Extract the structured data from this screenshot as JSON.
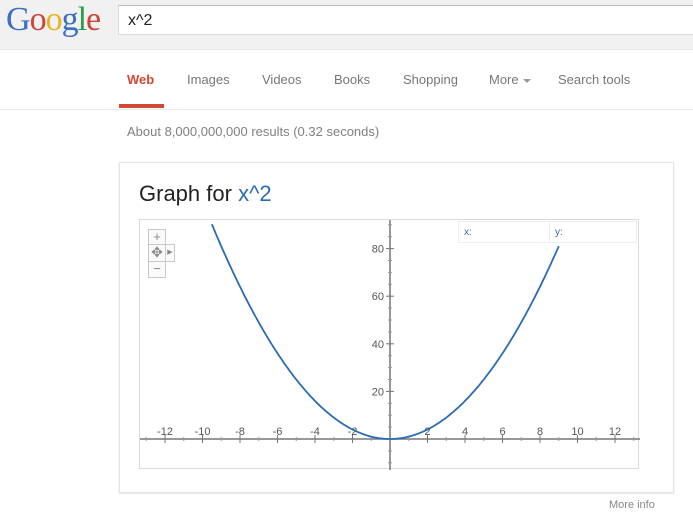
{
  "header": {
    "logo_letters": [
      "G",
      "o",
      "o",
      "g",
      "l",
      "e"
    ],
    "search_value": "x^2"
  },
  "tabs": [
    {
      "label": "Web",
      "active": true
    },
    {
      "label": "Images",
      "active": false
    },
    {
      "label": "Videos",
      "active": false
    },
    {
      "label": "Books",
      "active": false
    },
    {
      "label": "Shopping",
      "active": false
    },
    {
      "label": "More",
      "active": false
    },
    {
      "label": "Search tools",
      "active": false
    }
  ],
  "results_stats": "About 8,000,000,000 results (0.32 seconds)",
  "card": {
    "title_prefix": "Graph for",
    "title_query": "x^2",
    "readout_x_label": "x:",
    "readout_y_label": "y:",
    "zoom_in_label": "+",
    "zoom_out_label": "−",
    "pan_icon": "move-icon",
    "more_info": "More info"
  },
  "colors": {
    "accent": "#d14836",
    "curve": "#2a6cb3",
    "axis": "#777777"
  },
  "chart_data": {
    "type": "line",
    "title": "Graph for x^2",
    "function": "x^2",
    "xlim": [
      -13.3,
      13.3
    ],
    "ylim": [
      -12.5,
      92
    ],
    "x_ticks": [
      -12,
      -10,
      -8,
      -6,
      -4,
      -2,
      2,
      4,
      6,
      8,
      10,
      12
    ],
    "y_ticks": [
      20,
      40,
      60,
      80
    ],
    "series": [
      {
        "name": "x^2",
        "x_range": [
          -9.5,
          9.0
        ]
      }
    ]
  }
}
